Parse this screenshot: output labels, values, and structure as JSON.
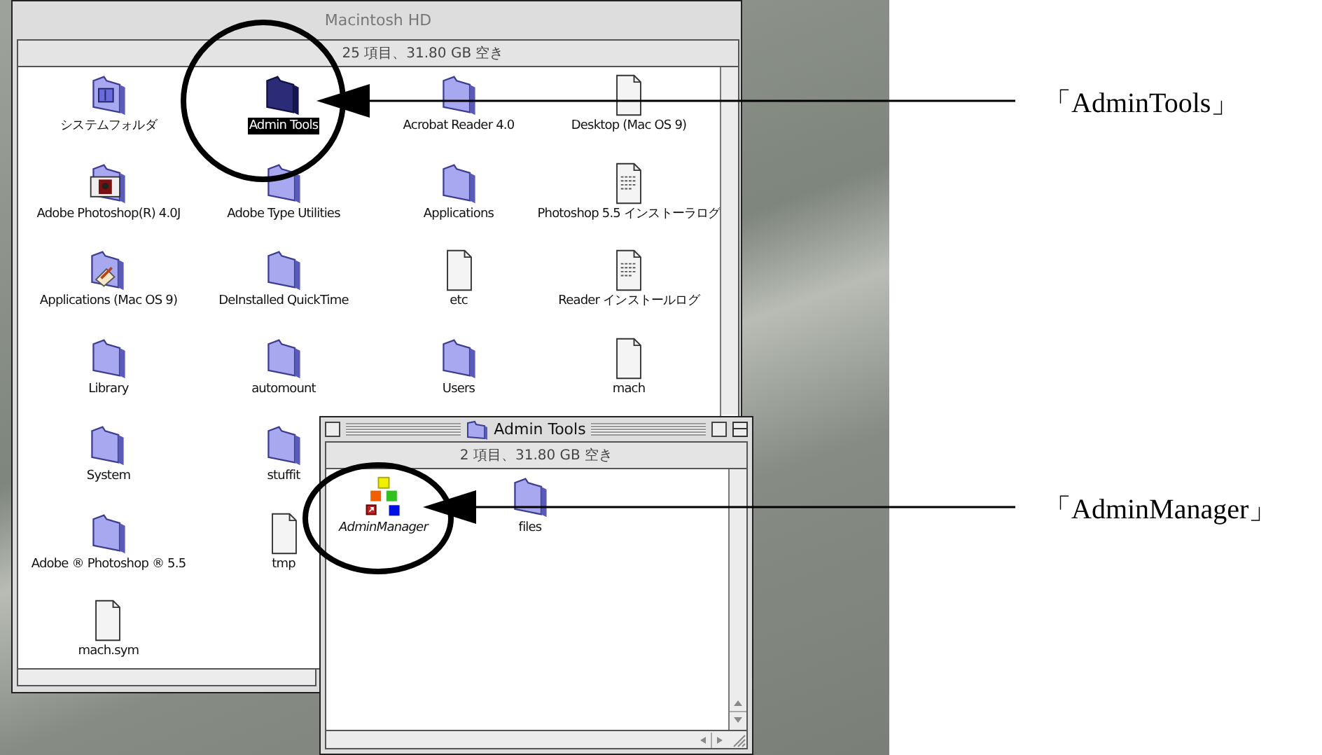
{
  "main_window": {
    "title": "Macintosh HD",
    "info": "25 項目、31.80 GB 空き",
    "rows": [
      [
        {
          "name": "システムフォルダ",
          "kind": "system-folder",
          "selected": false
        },
        {
          "name": "Admin Tools",
          "kind": "folder",
          "selected": true
        },
        {
          "name": "Acrobat Reader 4.0",
          "kind": "folder",
          "selected": false
        },
        {
          "name": "Desktop (Mac OS 9)",
          "kind": "document",
          "selected": false
        }
      ],
      [
        {
          "name": "Adobe Photoshop(R) 4.0J",
          "kind": "app-folder",
          "selected": false
        },
        {
          "name": "Adobe Type Utilities",
          "kind": "folder",
          "selected": false
        },
        {
          "name": "Applications",
          "kind": "folder",
          "selected": false
        },
        {
          "name": "Photoshop 5.5 インストーラログ",
          "kind": "text-document",
          "selected": false
        }
      ],
      [
        {
          "name": "Applications (Mac OS 9)",
          "kind": "apps-folder",
          "selected": false
        },
        {
          "name": "DeInstalled QuickTime",
          "kind": "folder",
          "selected": false
        },
        {
          "name": "etc",
          "kind": "document",
          "selected": false
        },
        {
          "name": "Reader インストールログ",
          "kind": "text-document",
          "selected": false
        }
      ],
      [
        {
          "name": "Library",
          "kind": "folder",
          "selected": false
        },
        {
          "name": "automount",
          "kind": "folder",
          "selected": false
        },
        {
          "name": "Users",
          "kind": "folder",
          "selected": false
        },
        {
          "name": "mach",
          "kind": "document",
          "selected": false
        }
      ],
      [
        {
          "name": "System",
          "kind": "folder",
          "selected": false
        },
        {
          "name": "stuffit",
          "kind": "folder",
          "selected": false
        }
      ],
      [
        {
          "name": "Adobe ® Photoshop ® 5.5",
          "kind": "folder",
          "selected": false
        },
        {
          "name": "tmp",
          "kind": "document",
          "selected": false
        }
      ],
      [
        {
          "name": "mach.sym",
          "kind": "document",
          "selected": false
        }
      ]
    ]
  },
  "sub_window": {
    "title": "Admin Tools",
    "info": "2 項目、31.80 GB 空き",
    "items": [
      {
        "name": "AdminManager",
        "kind": "alias-app",
        "selected": false
      },
      {
        "name": "files",
        "kind": "folder",
        "selected": false
      }
    ]
  },
  "callouts": [
    {
      "label": "「AdminTools」"
    },
    {
      "label": "「AdminManager」"
    }
  ]
}
